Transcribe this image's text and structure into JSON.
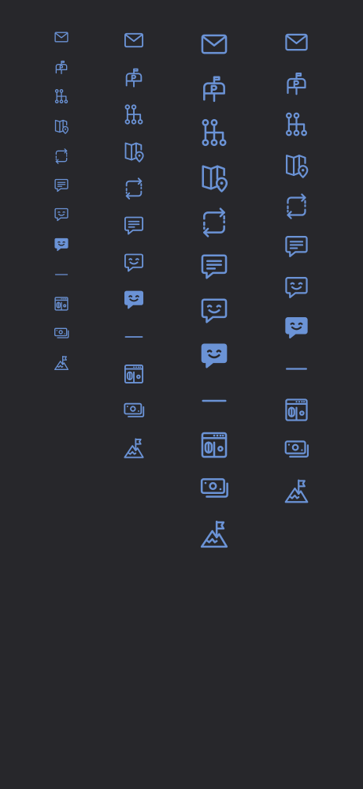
{
  "theme": {
    "background": "#27272b",
    "accent": "#6b93d6"
  },
  "icon_set": [
    "mail-icon",
    "mailbox-icon",
    "hierarchy-icon",
    "map-location-icon",
    "crop-rotate-icon",
    "message-text-icon",
    "message-smile-icon",
    "message-smile-filled-icon",
    "minus-icon",
    "atm-machine-icon",
    "money-cash-icon",
    "mountain-flag-icon"
  ],
  "columns": [
    "size-small",
    "size-medium",
    "size-large",
    "size-extra-large"
  ]
}
